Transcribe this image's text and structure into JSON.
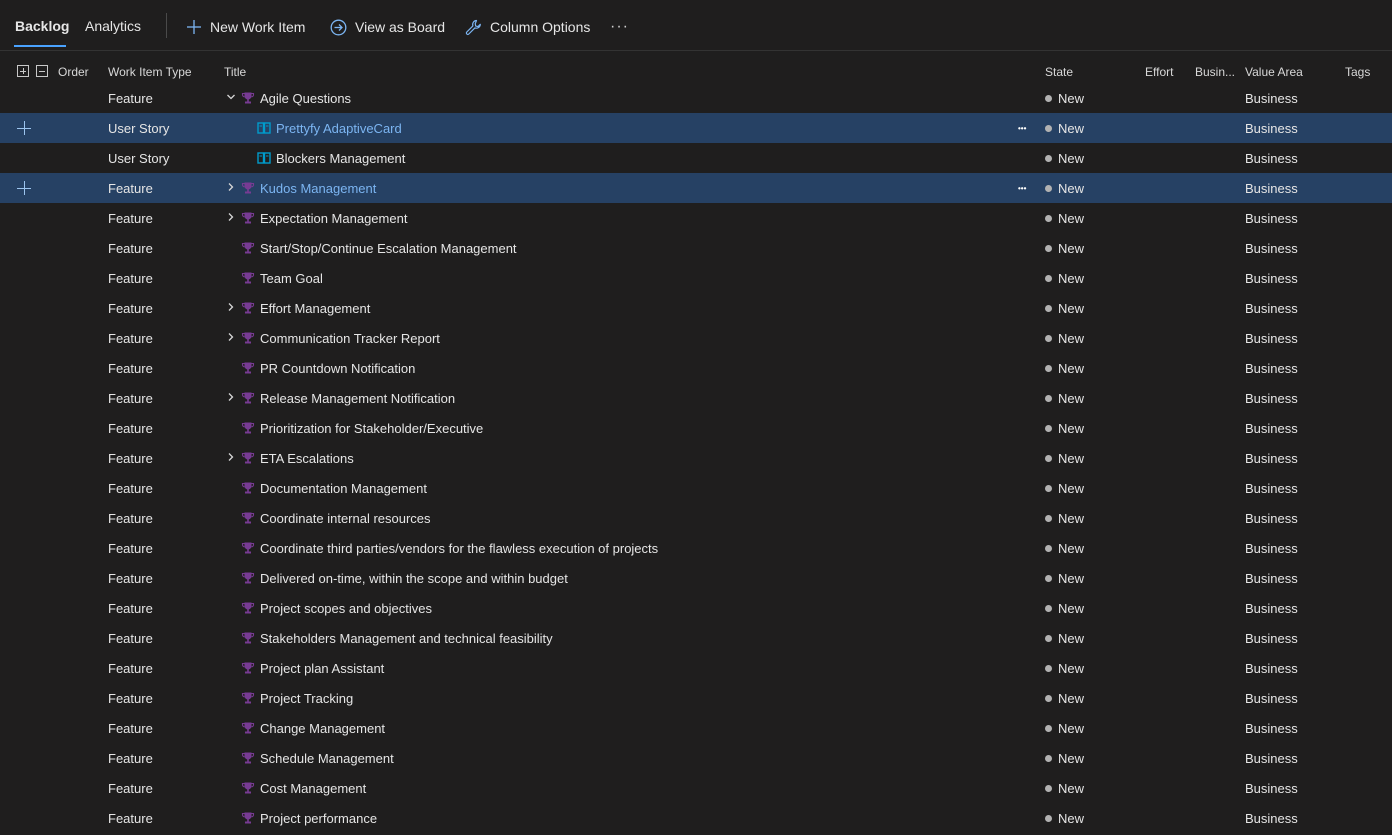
{
  "toolbar": {
    "tabs": [
      {
        "label": "Backlog",
        "active": true
      },
      {
        "label": "Analytics",
        "active": false
      }
    ],
    "new_work_item": "New Work Item",
    "view_as_board": "View as Board",
    "column_options": "Column Options",
    "more": "···"
  },
  "columns": {
    "order": "Order",
    "work_item_type": "Work Item Type",
    "title": "Title",
    "state": "State",
    "effort": "Effort",
    "business": "Busin...",
    "value_area": "Value Area",
    "tags": "Tags"
  },
  "colors": {
    "feature_icon": "#773b93",
    "story_icon": "#009ccc",
    "selected_row": "#264164",
    "link_text": "#7cb5f2",
    "state_new": "#b2b2b2"
  },
  "rows": [
    {
      "type": "Feature",
      "title": "Agile Questions",
      "state": "New",
      "value_area": "Business",
      "icon": "trophy-icon",
      "chevron": "down",
      "indent": 0,
      "selected": false
    },
    {
      "type": "User Story",
      "title": "Prettyfy AdaptiveCard",
      "state": "New",
      "value_area": "Business",
      "icon": "book-icon",
      "chevron": "none",
      "indent": 1,
      "selected": true
    },
    {
      "type": "User Story",
      "title": "Blockers Management",
      "state": "New",
      "value_area": "Business",
      "icon": "book-icon",
      "chevron": "none",
      "indent": 1,
      "selected": false
    },
    {
      "type": "Feature",
      "title": "Kudos Management",
      "state": "New",
      "value_area": "Business",
      "icon": "trophy-icon",
      "chevron": "right",
      "indent": 0,
      "selected": true
    },
    {
      "type": "Feature",
      "title": "Expectation Management",
      "state": "New",
      "value_area": "Business",
      "icon": "trophy-icon",
      "chevron": "right",
      "indent": 0,
      "selected": false
    },
    {
      "type": "Feature",
      "title": "Start/Stop/Continue Escalation Management",
      "state": "New",
      "value_area": "Business",
      "icon": "trophy-icon",
      "chevron": "none",
      "indent": 0,
      "selected": false
    },
    {
      "type": "Feature",
      "title": "Team Goal",
      "state": "New",
      "value_area": "Business",
      "icon": "trophy-icon",
      "chevron": "none",
      "indent": 0,
      "selected": false
    },
    {
      "type": "Feature",
      "title": "Effort Management",
      "state": "New",
      "value_area": "Business",
      "icon": "trophy-icon",
      "chevron": "right",
      "indent": 0,
      "selected": false
    },
    {
      "type": "Feature",
      "title": "Communication Tracker Report",
      "state": "New",
      "value_area": "Business",
      "icon": "trophy-icon",
      "chevron": "right",
      "indent": 0,
      "selected": false
    },
    {
      "type": "Feature",
      "title": "PR Countdown Notification",
      "state": "New",
      "value_area": "Business",
      "icon": "trophy-icon",
      "chevron": "none",
      "indent": 0,
      "selected": false
    },
    {
      "type": "Feature",
      "title": "Release Management Notification",
      "state": "New",
      "value_area": "Business",
      "icon": "trophy-icon",
      "chevron": "right",
      "indent": 0,
      "selected": false
    },
    {
      "type": "Feature",
      "title": "Prioritization for Stakeholder/Executive",
      "state": "New",
      "value_area": "Business",
      "icon": "trophy-icon",
      "chevron": "none",
      "indent": 0,
      "selected": false
    },
    {
      "type": "Feature",
      "title": "ETA Escalations",
      "state": "New",
      "value_area": "Business",
      "icon": "trophy-icon",
      "chevron": "right",
      "indent": 0,
      "selected": false
    },
    {
      "type": "Feature",
      "title": "Documentation Management",
      "state": "New",
      "value_area": "Business",
      "icon": "trophy-icon",
      "chevron": "none",
      "indent": 0,
      "selected": false
    },
    {
      "type": "Feature",
      "title": "Coordinate internal resources",
      "state": "New",
      "value_area": "Business",
      "icon": "trophy-icon",
      "chevron": "none",
      "indent": 0,
      "selected": false
    },
    {
      "type": "Feature",
      "title": "Coordinate third parties/vendors for the flawless execution of projects",
      "state": "New",
      "value_area": "Business",
      "icon": "trophy-icon",
      "chevron": "none",
      "indent": 0,
      "selected": false
    },
    {
      "type": "Feature",
      "title": "Delivered on-time, within the scope and within budget",
      "state": "New",
      "value_area": "Business",
      "icon": "trophy-icon",
      "chevron": "none",
      "indent": 0,
      "selected": false
    },
    {
      "type": "Feature",
      "title": "Project scopes and objectives",
      "state": "New",
      "value_area": "Business",
      "icon": "trophy-icon",
      "chevron": "none",
      "indent": 0,
      "selected": false
    },
    {
      "type": "Feature",
      "title": "Stakeholders Management and technical feasibility",
      "state": "New",
      "value_area": "Business",
      "icon": "trophy-icon",
      "chevron": "none",
      "indent": 0,
      "selected": false
    },
    {
      "type": "Feature",
      "title": "Project plan Assistant",
      "state": "New",
      "value_area": "Business",
      "icon": "trophy-icon",
      "chevron": "none",
      "indent": 0,
      "selected": false
    },
    {
      "type": "Feature",
      "title": "Project Tracking",
      "state": "New",
      "value_area": "Business",
      "icon": "trophy-icon",
      "chevron": "none",
      "indent": 0,
      "selected": false
    },
    {
      "type": "Feature",
      "title": "Change Management",
      "state": "New",
      "value_area": "Business",
      "icon": "trophy-icon",
      "chevron": "none",
      "indent": 0,
      "selected": false
    },
    {
      "type": "Feature",
      "title": "Schedule Management",
      "state": "New",
      "value_area": "Business",
      "icon": "trophy-icon",
      "chevron": "none",
      "indent": 0,
      "selected": false
    },
    {
      "type": "Feature",
      "title": "Cost Management",
      "state": "New",
      "value_area": "Business",
      "icon": "trophy-icon",
      "chevron": "none",
      "indent": 0,
      "selected": false
    },
    {
      "type": "Feature",
      "title": "Project performance",
      "state": "New",
      "value_area": "Business",
      "icon": "trophy-icon",
      "chevron": "none",
      "indent": 0,
      "selected": false
    }
  ]
}
